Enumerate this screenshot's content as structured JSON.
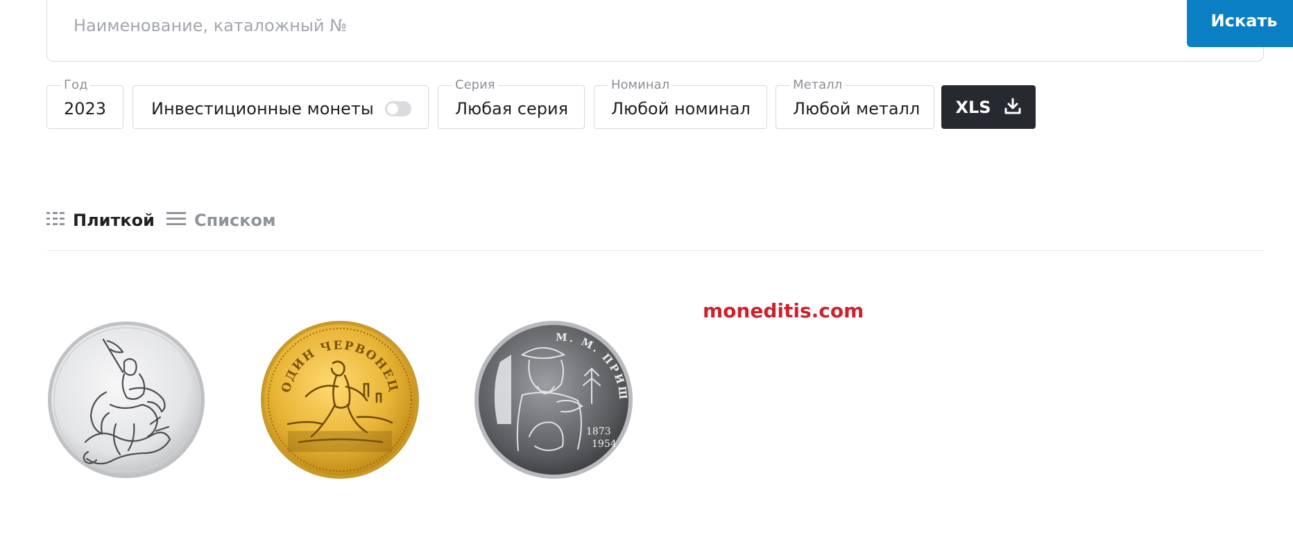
{
  "search": {
    "placeholder": "Наименование, каталожный №",
    "button_label": "Искать"
  },
  "filters": {
    "year": {
      "label": "Год",
      "value": "2023"
    },
    "investment": {
      "value": "Инвестиционные монеты",
      "toggle_on": false
    },
    "series": {
      "label": "Серия",
      "value": "Любая серия"
    },
    "denomination": {
      "label": "Номинал",
      "value": "Любой номинал"
    },
    "metal": {
      "label": "Металл",
      "value": "Любой металл"
    },
    "export": {
      "label": "XLS",
      "icon": "download-icon"
    }
  },
  "view": {
    "tile_label": "Плиткой",
    "tile_icon": "grid-icon",
    "list_label": "Списком",
    "list_icon": "list-icon",
    "active": "tile"
  },
  "watermark": "moneditis.com",
  "coins": [
    {
      "metal": "silver",
      "subject": "George the Victorious"
    },
    {
      "metal": "gold",
      "subject": "Chervonets sower",
      "inscription": "ОДИН ЧЕРВОНЕЦ"
    },
    {
      "metal": "silver",
      "subject": "M. M. Prishvin",
      "inscription": "М. М. ПРИШВИН",
      "years": [
        "1873",
        "1954"
      ]
    }
  ],
  "colors": {
    "accent": "#0b7fc4",
    "dark_button": "#262a30",
    "watermark": "#d0212a"
  }
}
